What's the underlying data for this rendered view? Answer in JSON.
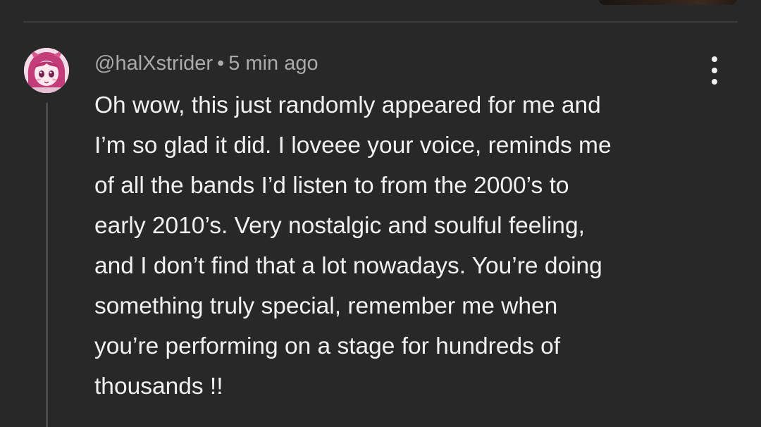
{
  "comment": {
    "author": "@halXstrider",
    "separator": "•",
    "timestamp": "5 min ago",
    "text": "Oh wow, this just randomly appeared for me and\nI’m so glad it did. I loveee your voice, reminds me\nof all the bands I’d listen to from the 2000’s to\nearly 2010’s. Very nostalgic and soulful feeling,\nand I don’t find that a lot nowadays. You’re doing\nsomething truly special, remember me when\nyou’re performing on a stage for hundreds of\nthousands !!"
  },
  "icons": {
    "more": "more-vertical-icon",
    "avatar": "anime-avatar"
  },
  "colors": {
    "background": "#282828",
    "text_primary": "#f1f1f1",
    "text_secondary": "#aaaaaa",
    "divider": "#3d3d3d",
    "thread_line": "#4a4a4a"
  }
}
